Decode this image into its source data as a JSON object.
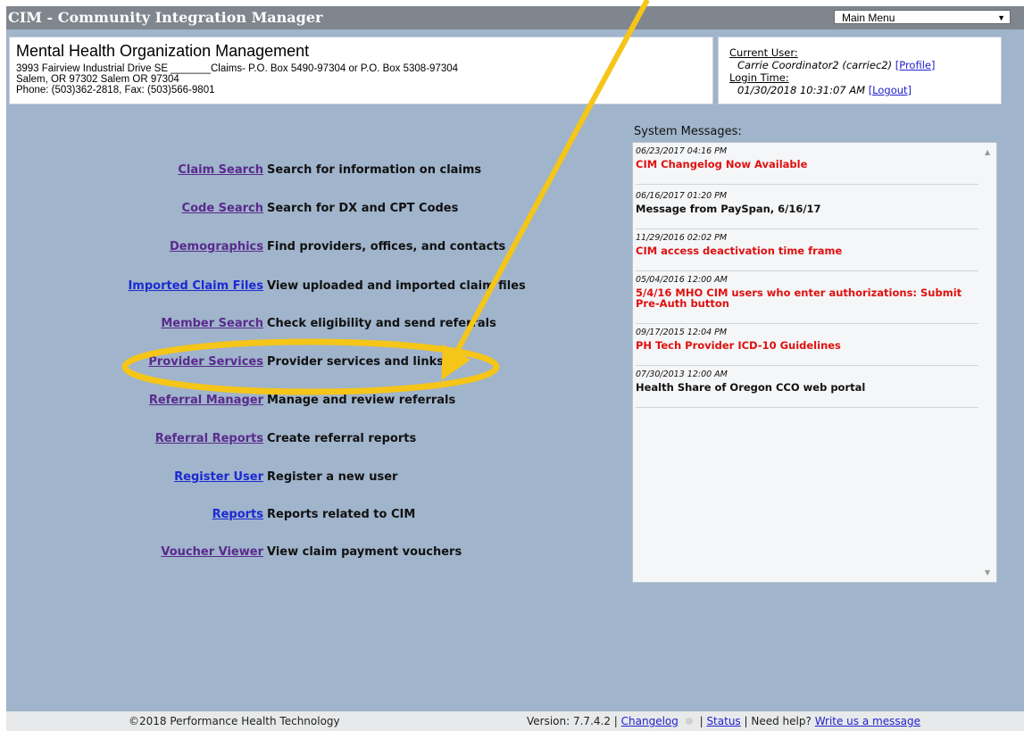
{
  "app": {
    "title": "CIM - Community Integration Manager",
    "menu_select_value": "Main Menu"
  },
  "org": {
    "name": "Mental Health Organization Management",
    "address1": "3993 Fairview Industrial Drive SE _______Claims- P.O. Box 5490-97304 or P.O. Box 5308-97304",
    "address2": "Salem, OR 97302 Salem OR 97304",
    "phone": "Phone: (503)362-2818, Fax: (503)566-9801"
  },
  "user": {
    "current_user_label": "Current User:",
    "current_user_value": "Carrie Coordinator2 (carriec2)",
    "profile_link": "[Profile]",
    "login_time_label": "Login Time:",
    "login_time_value": "01/30/2018 10:31:07 AM",
    "logout_link": "[Logout]"
  },
  "menu": [
    {
      "link": "Claim Search",
      "desc": "Search for information on claims"
    },
    {
      "link": "Code Search",
      "desc": "Search for DX and CPT Codes"
    },
    {
      "link": "Demographics",
      "desc": "Find providers, offices, and contacts"
    },
    {
      "link": "Imported Claim Files",
      "desc": "View uploaded and imported claim files"
    },
    {
      "link": "Member Search",
      "desc": "Check eligibility and send referrals"
    },
    {
      "link": "Provider Services",
      "desc": "Provider services and links"
    },
    {
      "link": "Referral Manager",
      "desc": "Manage and review referrals"
    },
    {
      "link": "Referral Reports",
      "desc": "Create referral reports"
    },
    {
      "link": "Register User",
      "desc": "Register a new user"
    },
    {
      "link": "Reports",
      "desc": "Reports related to CIM"
    },
    {
      "link": "Voucher Viewer",
      "desc": "View claim payment vouchers"
    }
  ],
  "system_messages": {
    "label": "System Messages:",
    "items": [
      {
        "date": "06/23/2017 04:16 PM",
        "title": "CIM Changelog Now Available",
        "color": "#e01010"
      },
      {
        "date": "06/16/2017 01:20 PM",
        "title": "Message from PaySpan, 6/16/17",
        "color": "#111111"
      },
      {
        "date": "11/29/2016 02:02 PM",
        "title": "CIM access deactivation time frame",
        "color": "#e01010"
      },
      {
        "date": "05/04/2016 12:00 AM",
        "title": "5/4/16 MHO CIM users who enter authorizations: Submit Pre-Auth button",
        "color": "#e01010"
      },
      {
        "date": "09/17/2015 12:04 PM",
        "title": "PH Tech Provider ICD-10 Guidelines",
        "color": "#e01010"
      },
      {
        "date": "07/30/2013 12:00 AM",
        "title": "Health Share of Oregon CCO web portal",
        "color": "#111111"
      }
    ]
  },
  "footer": {
    "copyright": "©2018 Performance Health Technology",
    "version": "Version: 7.7.4.2 |",
    "changelog": "Changelog",
    "sep": "|",
    "status": "Status",
    "help": "| Need help?",
    "write": "Write us a message"
  },
  "colors": {
    "page_bg": "#a0b4cb",
    "titlebar": "#80868e",
    "annotation": "#f5c518"
  }
}
